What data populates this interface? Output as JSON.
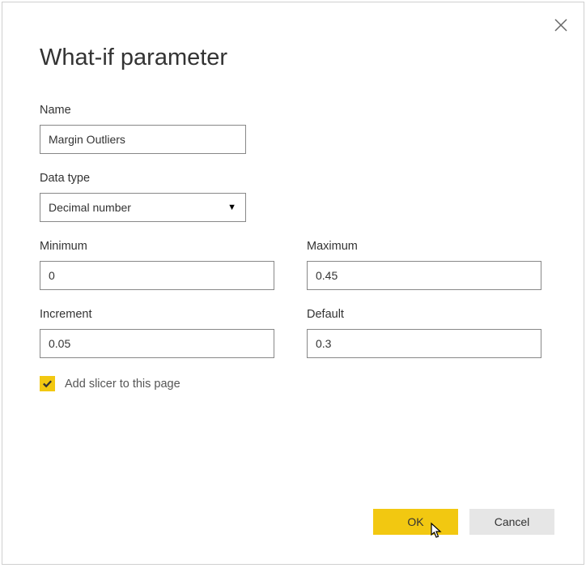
{
  "dialog": {
    "title": "What-if parameter"
  },
  "fields": {
    "name": {
      "label": "Name",
      "value": "Margin Outliers"
    },
    "datatype": {
      "label": "Data type",
      "value": "Decimal number"
    },
    "minimum": {
      "label": "Minimum",
      "value": "0"
    },
    "maximum": {
      "label": "Maximum",
      "value": "0.45"
    },
    "increment": {
      "label": "Increment",
      "value": "0.05"
    },
    "default": {
      "label": "Default",
      "value": "0.3"
    }
  },
  "checkbox": {
    "label": "Add slicer to this page",
    "checked": true
  },
  "buttons": {
    "ok": "OK",
    "cancel": "Cancel"
  },
  "colors": {
    "accent": "#f2c811"
  }
}
